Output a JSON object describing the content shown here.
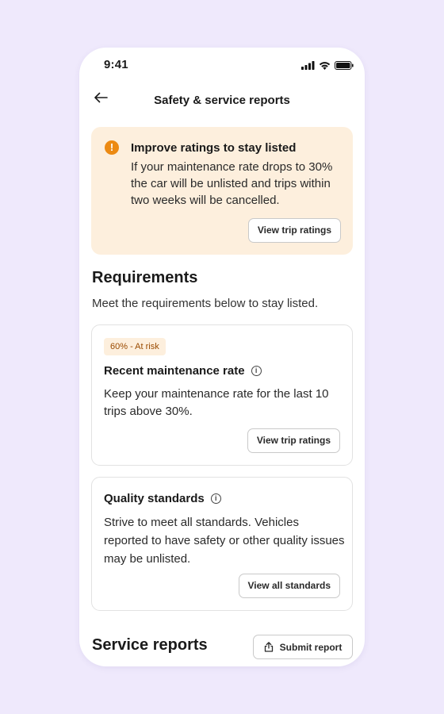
{
  "status_bar": {
    "time": "9:41"
  },
  "header": {
    "title": "Safety & service reports"
  },
  "alert": {
    "icon": "exclamation-icon",
    "title": "Improve ratings to stay listed",
    "body": "If your maintenance rate drops to 30% the car will be unlisted and trips within two weeks will be cancelled.",
    "button_label": "View trip ratings"
  },
  "requirements": {
    "heading": "Requirements",
    "subtitle": "Meet the requirements below to stay listed.",
    "cards": [
      {
        "badge": "60% - At risk",
        "title": "Recent maintenance rate",
        "body": "Keep your maintenance rate for the last 10 trips above 30%.",
        "button_label": "View trip ratings"
      },
      {
        "title": "Quality standards",
        "body": "Strive to meet all standards. Vehicles reported to have safety or other quality issues may be unlisted.",
        "button_label": "View all standards"
      }
    ]
  },
  "service_reports": {
    "heading": "Service reports",
    "submit_label": "Submit report"
  },
  "colors": {
    "background": "#efe9fc",
    "alert_bg": "#fdefdd",
    "alert_icon": "#ec8a13",
    "badge_text": "#9a4a00"
  }
}
